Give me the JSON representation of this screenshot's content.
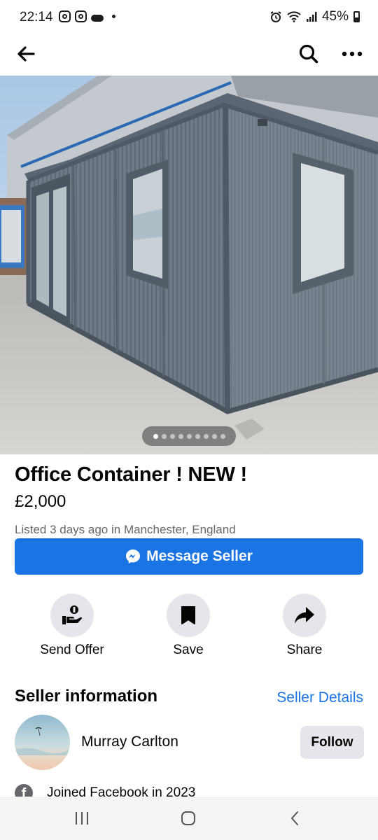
{
  "status_bar": {
    "time": "22:14",
    "battery": "45%"
  },
  "listing": {
    "title": "Office Container ! NEW !",
    "price": "£2,000",
    "listed": "Listed 3 days ago in Manchester, England",
    "photo_index": 1,
    "photo_count": 9
  },
  "actions": {
    "message_seller": "Message Seller",
    "send_offer": "Send Offer",
    "save": "Save",
    "share": "Share"
  },
  "seller": {
    "section_title": "Seller information",
    "details_link": "Seller Details",
    "name": "Murray Carlton",
    "follow": "Follow",
    "joined": "Joined Facebook in 2023"
  },
  "colors": {
    "accent": "#1b74e4",
    "secondary_text": "#65676b",
    "button_gray": "#e4e6eb"
  },
  "icons": [
    "back-arrow-icon",
    "search-icon",
    "more-icon",
    "messenger-icon",
    "send-offer-icon",
    "bookmark-icon",
    "share-arrow-icon",
    "facebook-icon"
  ]
}
